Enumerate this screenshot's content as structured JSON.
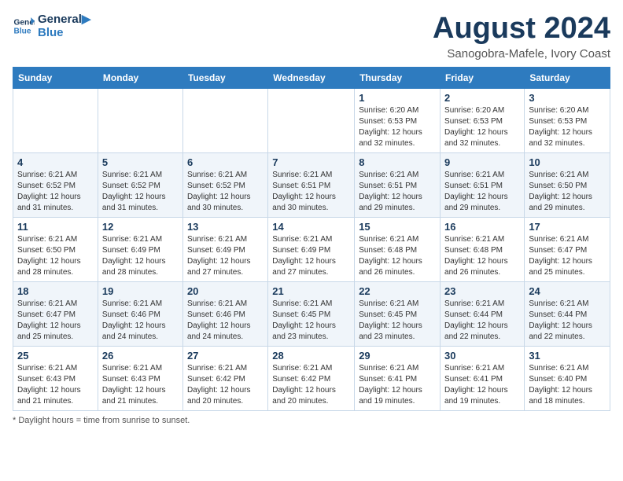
{
  "logo": {
    "line1": "General",
    "line2": "Blue"
  },
  "title": "August 2024",
  "subtitle": "Sanogobra-Mafele, Ivory Coast",
  "days_of_week": [
    "Sunday",
    "Monday",
    "Tuesday",
    "Wednesday",
    "Thursday",
    "Friday",
    "Saturday"
  ],
  "footer": "Daylight hours",
  "weeks": [
    [
      {
        "day": "",
        "info": ""
      },
      {
        "day": "",
        "info": ""
      },
      {
        "day": "",
        "info": ""
      },
      {
        "day": "",
        "info": ""
      },
      {
        "day": "1",
        "info": "Sunrise: 6:20 AM\nSunset: 6:53 PM\nDaylight: 12 hours\nand 32 minutes."
      },
      {
        "day": "2",
        "info": "Sunrise: 6:20 AM\nSunset: 6:53 PM\nDaylight: 12 hours\nand 32 minutes."
      },
      {
        "day": "3",
        "info": "Sunrise: 6:20 AM\nSunset: 6:53 PM\nDaylight: 12 hours\nand 32 minutes."
      }
    ],
    [
      {
        "day": "4",
        "info": "Sunrise: 6:21 AM\nSunset: 6:52 PM\nDaylight: 12 hours\nand 31 minutes."
      },
      {
        "day": "5",
        "info": "Sunrise: 6:21 AM\nSunset: 6:52 PM\nDaylight: 12 hours\nand 31 minutes."
      },
      {
        "day": "6",
        "info": "Sunrise: 6:21 AM\nSunset: 6:52 PM\nDaylight: 12 hours\nand 30 minutes."
      },
      {
        "day": "7",
        "info": "Sunrise: 6:21 AM\nSunset: 6:51 PM\nDaylight: 12 hours\nand 30 minutes."
      },
      {
        "day": "8",
        "info": "Sunrise: 6:21 AM\nSunset: 6:51 PM\nDaylight: 12 hours\nand 29 minutes."
      },
      {
        "day": "9",
        "info": "Sunrise: 6:21 AM\nSunset: 6:51 PM\nDaylight: 12 hours\nand 29 minutes."
      },
      {
        "day": "10",
        "info": "Sunrise: 6:21 AM\nSunset: 6:50 PM\nDaylight: 12 hours\nand 29 minutes."
      }
    ],
    [
      {
        "day": "11",
        "info": "Sunrise: 6:21 AM\nSunset: 6:50 PM\nDaylight: 12 hours\nand 28 minutes."
      },
      {
        "day": "12",
        "info": "Sunrise: 6:21 AM\nSunset: 6:49 PM\nDaylight: 12 hours\nand 28 minutes."
      },
      {
        "day": "13",
        "info": "Sunrise: 6:21 AM\nSunset: 6:49 PM\nDaylight: 12 hours\nand 27 minutes."
      },
      {
        "day": "14",
        "info": "Sunrise: 6:21 AM\nSunset: 6:49 PM\nDaylight: 12 hours\nand 27 minutes."
      },
      {
        "day": "15",
        "info": "Sunrise: 6:21 AM\nSunset: 6:48 PM\nDaylight: 12 hours\nand 26 minutes."
      },
      {
        "day": "16",
        "info": "Sunrise: 6:21 AM\nSunset: 6:48 PM\nDaylight: 12 hours\nand 26 minutes."
      },
      {
        "day": "17",
        "info": "Sunrise: 6:21 AM\nSunset: 6:47 PM\nDaylight: 12 hours\nand 25 minutes."
      }
    ],
    [
      {
        "day": "18",
        "info": "Sunrise: 6:21 AM\nSunset: 6:47 PM\nDaylight: 12 hours\nand 25 minutes."
      },
      {
        "day": "19",
        "info": "Sunrise: 6:21 AM\nSunset: 6:46 PM\nDaylight: 12 hours\nand 24 minutes."
      },
      {
        "day": "20",
        "info": "Sunrise: 6:21 AM\nSunset: 6:46 PM\nDaylight: 12 hours\nand 24 minutes."
      },
      {
        "day": "21",
        "info": "Sunrise: 6:21 AM\nSunset: 6:45 PM\nDaylight: 12 hours\nand 23 minutes."
      },
      {
        "day": "22",
        "info": "Sunrise: 6:21 AM\nSunset: 6:45 PM\nDaylight: 12 hours\nand 23 minutes."
      },
      {
        "day": "23",
        "info": "Sunrise: 6:21 AM\nSunset: 6:44 PM\nDaylight: 12 hours\nand 22 minutes."
      },
      {
        "day": "24",
        "info": "Sunrise: 6:21 AM\nSunset: 6:44 PM\nDaylight: 12 hours\nand 22 minutes."
      }
    ],
    [
      {
        "day": "25",
        "info": "Sunrise: 6:21 AM\nSunset: 6:43 PM\nDaylight: 12 hours\nand 21 minutes."
      },
      {
        "day": "26",
        "info": "Sunrise: 6:21 AM\nSunset: 6:43 PM\nDaylight: 12 hours\nand 21 minutes."
      },
      {
        "day": "27",
        "info": "Sunrise: 6:21 AM\nSunset: 6:42 PM\nDaylight: 12 hours\nand 20 minutes."
      },
      {
        "day": "28",
        "info": "Sunrise: 6:21 AM\nSunset: 6:42 PM\nDaylight: 12 hours\nand 20 minutes."
      },
      {
        "day": "29",
        "info": "Sunrise: 6:21 AM\nSunset: 6:41 PM\nDaylight: 12 hours\nand 19 minutes."
      },
      {
        "day": "30",
        "info": "Sunrise: 6:21 AM\nSunset: 6:41 PM\nDaylight: 12 hours\nand 19 minutes."
      },
      {
        "day": "31",
        "info": "Sunrise: 6:21 AM\nSunset: 6:40 PM\nDaylight: 12 hours\nand 18 minutes."
      }
    ]
  ]
}
